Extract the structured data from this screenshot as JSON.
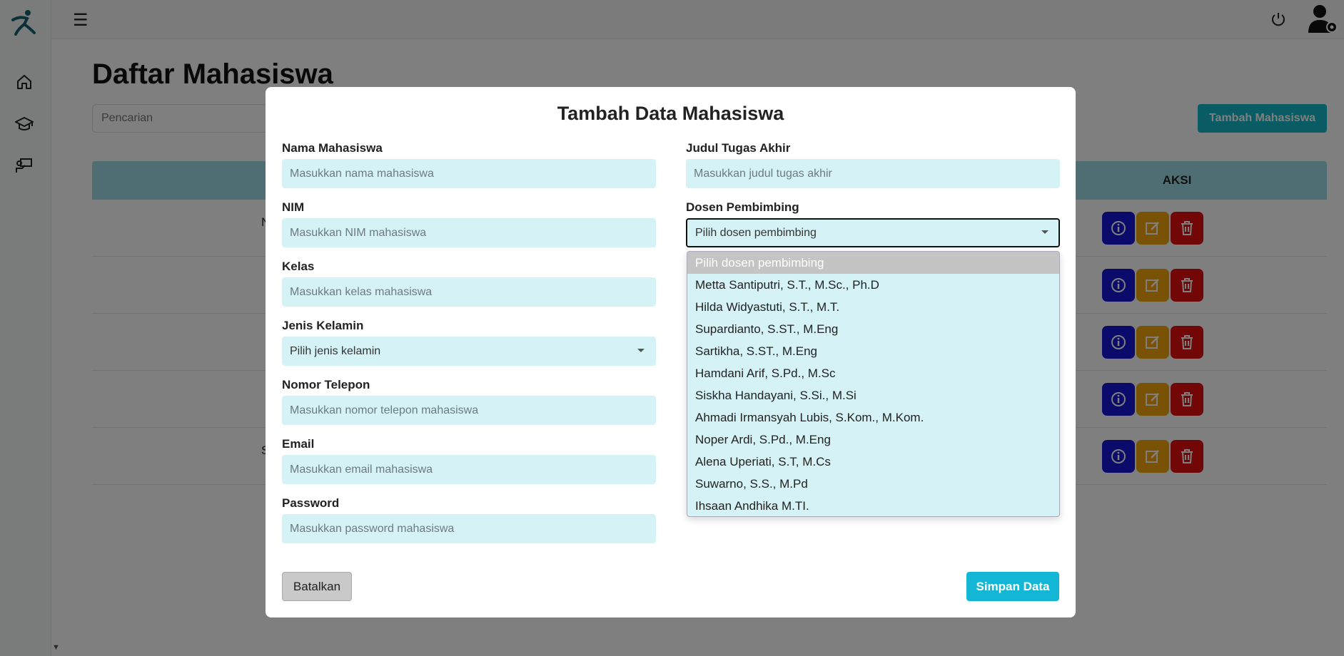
{
  "page": {
    "title": "Daftar Mahasiswa",
    "search_placeholder": "Pencarian",
    "add_button": "Tambah Mahasiswa"
  },
  "topbar": {
    "menu_icon": "hamburger-icon",
    "power_icon": "power-icon",
    "avatar_icon": "user-settings-icon"
  },
  "sidebar": {
    "items": [
      {
        "icon": "home-icon"
      },
      {
        "icon": "graduation-cap-icon"
      },
      {
        "icon": "lecturer-icon"
      }
    ]
  },
  "table": {
    "actions_header": "AKSI",
    "rows": [
      {
        "fragment": "N"
      },
      {
        "fragment": ""
      },
      {
        "fragment": ""
      },
      {
        "fragment": ""
      },
      {
        "fragment": "S"
      }
    ]
  },
  "modal": {
    "title": "Tambah Data Mahasiswa",
    "left": {
      "nama": {
        "label": "Nama Mahasiswa",
        "placeholder": "Masukkan nama mahasiswa"
      },
      "nim": {
        "label": "NIM",
        "placeholder": "Masukkan NIM mahasiswa"
      },
      "kelas": {
        "label": "Kelas",
        "placeholder": "Masukkan kelas mahasiswa"
      },
      "jenis_kelamin": {
        "label": "Jenis Kelamin",
        "value": "Pilih jenis kelamin"
      },
      "telepon": {
        "label": "Nomor Telepon",
        "placeholder": "Masukkan nomor telepon mahasiswa"
      },
      "email": {
        "label": "Email",
        "placeholder": "Masukkan email mahasiswa"
      },
      "password": {
        "label": "Password",
        "placeholder": "Masukkan password mahasiswa"
      }
    },
    "right": {
      "judul": {
        "label": "Judul Tugas Akhir",
        "placeholder": "Masukkan judul tugas akhir"
      },
      "dosen": {
        "label": "Dosen Pembimbing",
        "value": "Pilih dosen pembimbing"
      }
    },
    "dropdown_options": [
      "Pilih dosen pembimbing",
      "Metta Santiputri, S.T., M.Sc., Ph.D",
      "Hilda Widyastuti, S.T., M.T.",
      "Supardianto, S.ST., M.Eng",
      "Sartikha, S.ST., M.Eng",
      "Hamdani Arif, S.Pd., M.Sc",
      "Siskha Handayani, S.Si., M.Si",
      "Ahmadi Irmansyah Lubis, S.Kom., M.Kom.",
      "Noper Ardi, S.Pd., M.Eng",
      "Alena Uperiati, S.T, M.Cs",
      "Suwarno, S.S., M.Pd",
      "Ihsaan Andhika M.TI."
    ],
    "cancel_button": "Batalkan",
    "save_button": "Simpan Data"
  }
}
